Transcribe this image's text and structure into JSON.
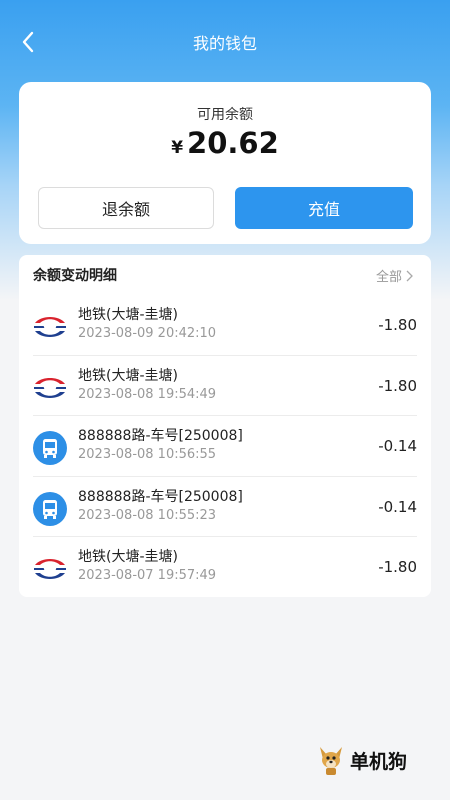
{
  "header": {
    "title": "我的钱包",
    "back_icon": "chevron-left-icon"
  },
  "balance": {
    "label": "可用余额",
    "currency": "¥",
    "amount": "20.62",
    "refund_label": "退余额",
    "recharge_label": "充值"
  },
  "details": {
    "title": "余额变动明细",
    "filter_label": "全部",
    "rows": [
      {
        "icon": "metro-logo-icon",
        "title": "地铁(大塘-圭塘)",
        "time": "2023-08-09 20:42:10",
        "amount": "-1.80"
      },
      {
        "icon": "metro-logo-icon",
        "title": "地铁(大塘-圭塘)",
        "time": "2023-08-08 19:54:49",
        "amount": "-1.80"
      },
      {
        "icon": "bus-icon",
        "title": "888888路-车号[250008]",
        "time": "2023-08-08 10:56:55",
        "amount": "-0.14"
      },
      {
        "icon": "bus-icon",
        "title": "888888路-车号[250008]",
        "time": "2023-08-08 10:55:23",
        "amount": "-0.14"
      },
      {
        "icon": "metro-logo-icon",
        "title": "地铁(大塘-圭塘)",
        "time": "2023-08-07 19:57:49",
        "amount": "-1.80"
      }
    ]
  },
  "watermark": {
    "text": "单机狗",
    "icon": "dog-mascot-icon"
  },
  "colors": {
    "accent": "#2d95ee",
    "metro_red": "#d9232e",
    "metro_blue": "#1e3f8f",
    "bus_blue": "#2d8fe6"
  }
}
